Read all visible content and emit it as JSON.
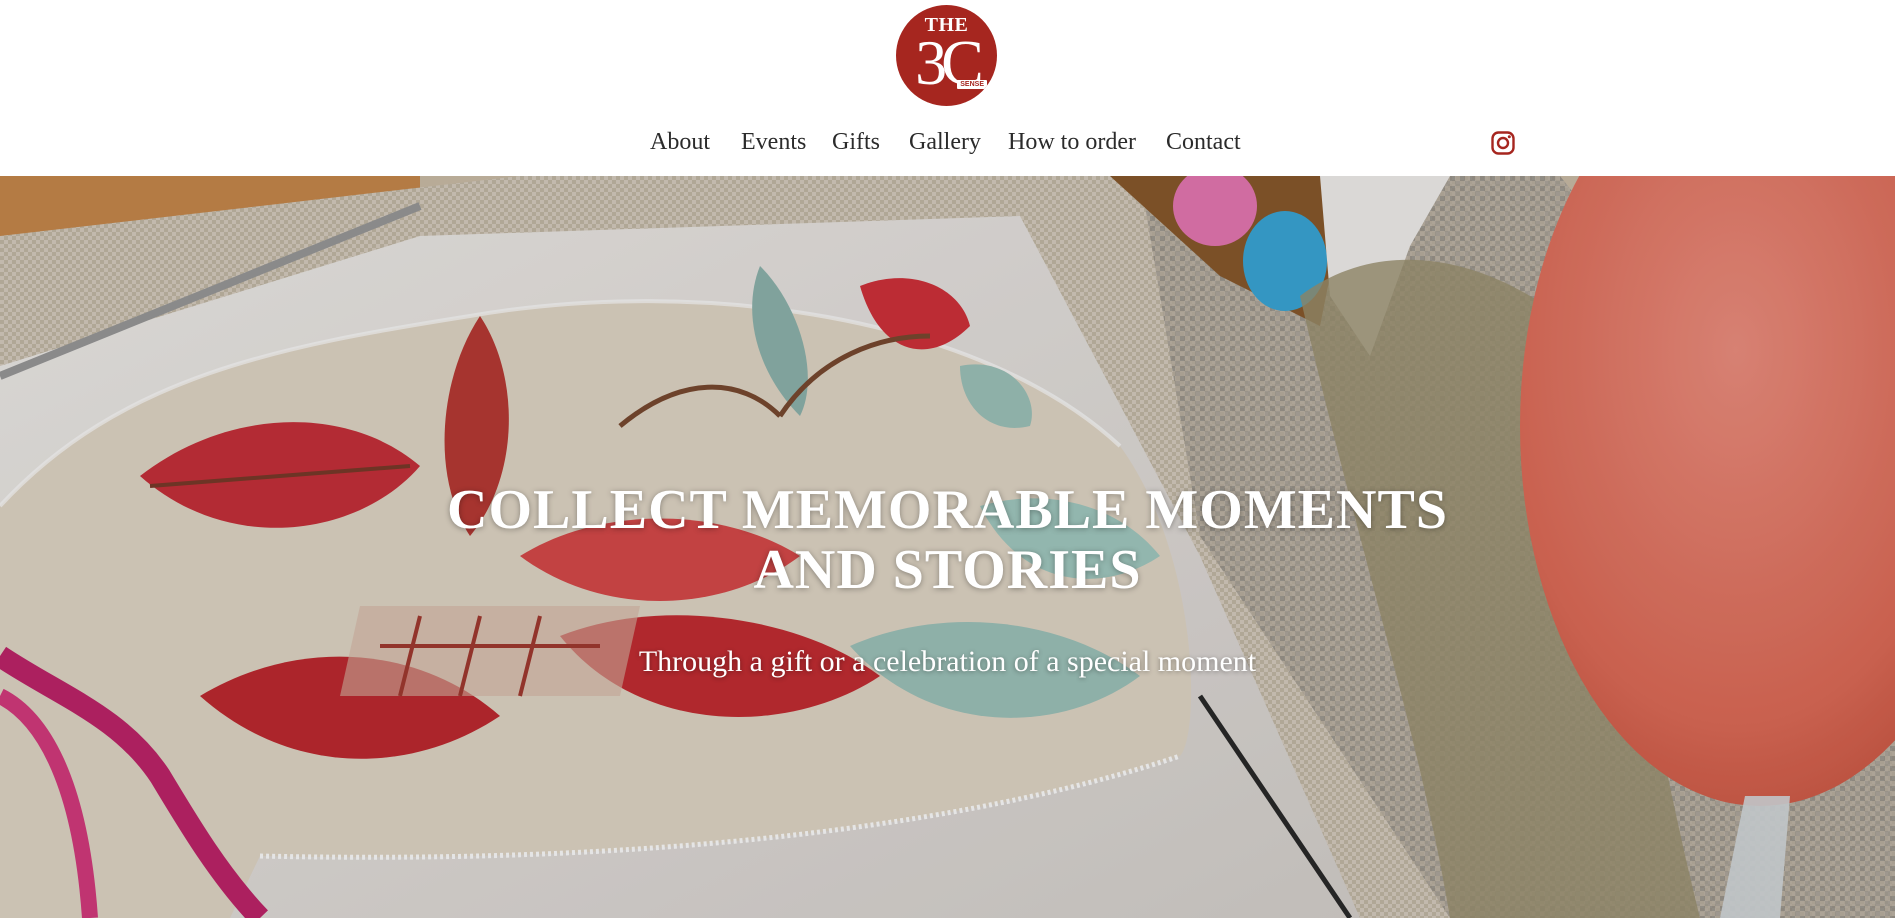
{
  "brand": {
    "logo_top": "THE",
    "logo_main": "3C",
    "logo_badge": "SENSE",
    "color": "#a6261f"
  },
  "nav": {
    "items": [
      {
        "label": "About"
      },
      {
        "label": "Events"
      },
      {
        "label": "Gifts"
      },
      {
        "label": "Gallery"
      },
      {
        "label": "How to order"
      },
      {
        "label": "Contact"
      }
    ],
    "social_icon": "instagram-icon"
  },
  "hero": {
    "title_line1": "COLLECT MEMORABLE MOMENTS",
    "title_line2": "AND STORIES",
    "subtitle": "Through a gift or a celebration of a special moment",
    "image": "embroidered-napkin-table-setting-photo"
  }
}
